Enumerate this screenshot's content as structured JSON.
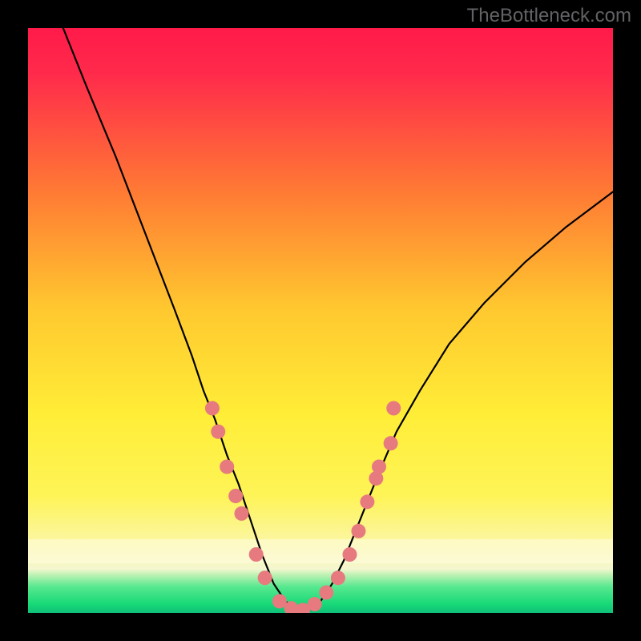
{
  "attribution": "TheBottleneck.com",
  "colors": {
    "frame": "#000000",
    "gradient_top": "#ff1a4a",
    "gradient_mid_upper": "#ff8c2a",
    "gradient_mid": "#ffe833",
    "gradient_low": "#fdf9b8",
    "gradient_bottom_band": "#1de37c",
    "curve_stroke": "#000000",
    "marker_fill": "#e67a7f",
    "attribution_text": "#636165"
  },
  "chart_data": {
    "type": "line",
    "title": "",
    "xlabel": "",
    "ylabel": "",
    "xlim": [
      0,
      100
    ],
    "ylim": [
      0,
      100
    ],
    "curve": {
      "comment": "V-shaped bottleneck curve; y=0 is optimal (green), y=100 worst (red). Minimum around x≈42–52.",
      "x": [
        6,
        10,
        15,
        20,
        25,
        28,
        30,
        32,
        34,
        36,
        38,
        40,
        42,
        44,
        46,
        48,
        50,
        52,
        54,
        56,
        58,
        60,
        63,
        67,
        72,
        78,
        85,
        92,
        100
      ],
      "y": [
        100,
        90,
        78,
        65,
        52,
        44,
        38,
        33,
        27,
        22,
        16,
        10,
        5,
        2,
        0.5,
        0.5,
        2,
        5,
        9,
        14,
        19,
        24,
        31,
        38,
        46,
        53,
        60,
        66,
        72
      ]
    },
    "markers": {
      "comment": "Pink dots clustered near the valley on both arms plus the flat bottom.",
      "points": [
        {
          "x": 31.5,
          "y": 35
        },
        {
          "x": 32.5,
          "y": 31
        },
        {
          "x": 34,
          "y": 25
        },
        {
          "x": 35.5,
          "y": 20
        },
        {
          "x": 36.5,
          "y": 17
        },
        {
          "x": 39,
          "y": 10
        },
        {
          "x": 40.5,
          "y": 6
        },
        {
          "x": 43,
          "y": 2
        },
        {
          "x": 45,
          "y": 0.8
        },
        {
          "x": 47,
          "y": 0.5
        },
        {
          "x": 49,
          "y": 1.5
        },
        {
          "x": 51,
          "y": 3.5
        },
        {
          "x": 53,
          "y": 6
        },
        {
          "x": 55,
          "y": 10
        },
        {
          "x": 56.5,
          "y": 14
        },
        {
          "x": 58,
          "y": 19
        },
        {
          "x": 59.5,
          "y": 23
        },
        {
          "x": 60,
          "y": 25
        },
        {
          "x": 62,
          "y": 29
        },
        {
          "x": 62.5,
          "y": 35
        }
      ]
    }
  }
}
